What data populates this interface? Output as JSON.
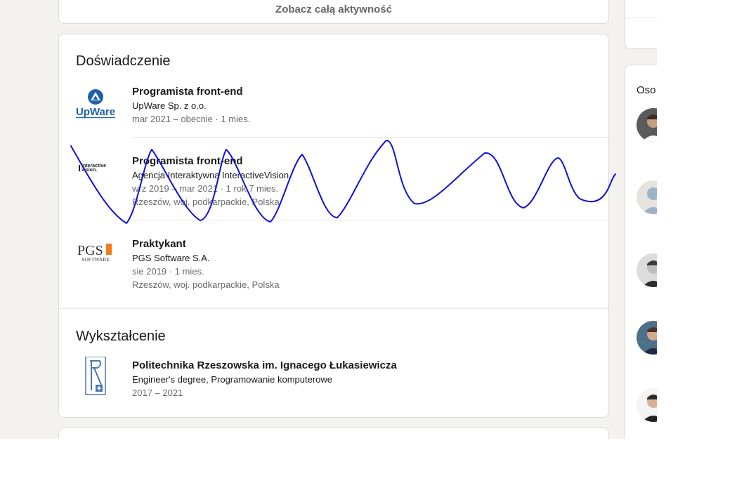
{
  "activity": {
    "see_all_label": "Zobacz całą aktywność"
  },
  "experience": {
    "heading": "Doświadczenie",
    "items": [
      {
        "title": "Programista front-end",
        "company": "UpWare Sp. z o.o.",
        "dates": "mar 2021 – obecnie · 1 mies.",
        "logo_text": "UpWare"
      },
      {
        "title": "Programista front-end",
        "company": "Agencja Interaktywna InteractiveVision",
        "dates": "wrz 2019 – mar 2021 · 1 rok 7 mies.",
        "location": "Rzeszów, woj. podkarpackie, Polska",
        "logo_text": "interactive vision"
      },
      {
        "title": "Praktykant",
        "company": "PGS Software S.A.",
        "dates": "sie 2019 · 1 mies.",
        "location": "Rzeszów, woj. podkarpackie, Polska",
        "logo_text": "PGS",
        "logo_subtext": "SOFTWARE"
      }
    ]
  },
  "education": {
    "heading": "Wykształcenie",
    "items": [
      {
        "school": "Politechnika Rzeszowska im. Ignacego Łukasiewicza",
        "degree": "Engineer's degree, Programowanie komputerowe",
        "years": "2017 – 2021"
      }
    ]
  },
  "sidebar": {
    "people_title": "Oso"
  },
  "colors": {
    "page_bg": "#f3f2ef",
    "card_bg": "#ffffff",
    "scribble": "#1010d8",
    "upware_blue": "#1f5fae",
    "pgs_orange": "#f07c1e"
  },
  "icons": {
    "upware_logo": "upware-logo",
    "interactivevision_logo": "interactivevision-logo",
    "pgs_logo": "pgs-logo",
    "prz_logo": "politechnika-rzeszowska-logo"
  }
}
